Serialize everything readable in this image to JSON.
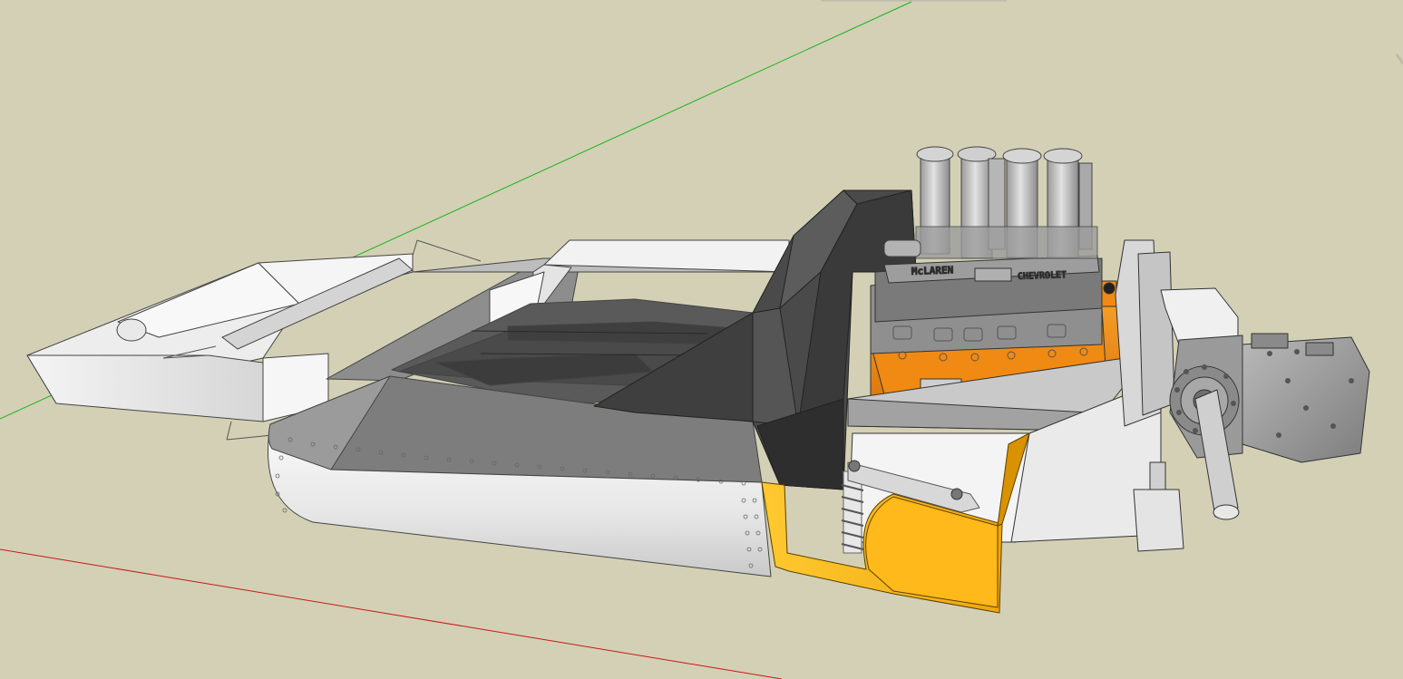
{
  "colors": {
    "background": "#d3d0b6",
    "axis_green": "#1bb51b",
    "axis_red": "#c41a1a",
    "engine_orange": "#f08a12",
    "suspension_yellow": "#f5b81e",
    "panel_white": "#f2f2f2",
    "panel_grey": "#8a8a8a",
    "dark_shell": "#454545"
  },
  "engine": {
    "valve_cover_left": "McLAREN",
    "valve_cover_right": "CHEVROLET"
  }
}
